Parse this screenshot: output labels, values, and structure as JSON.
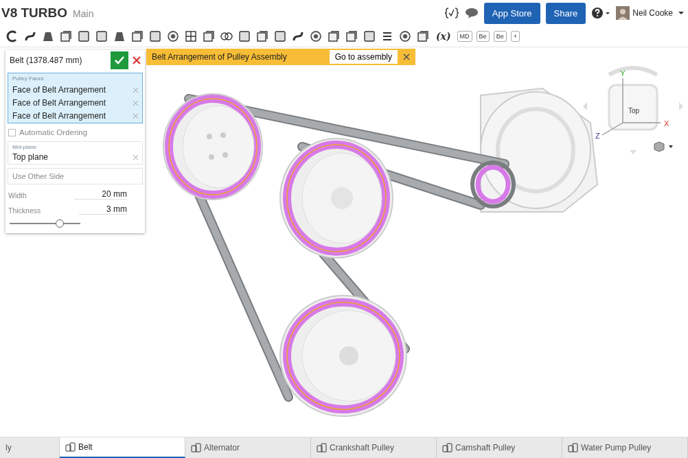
{
  "document": {
    "title": "V8 TURBO",
    "branch": "Main"
  },
  "top_bar": {
    "app_store": "App Store",
    "share": "Share",
    "user": "Neil Cooke"
  },
  "toolbar": {
    "text_tools": [
      "(x)",
      "MD",
      "Be",
      "Be",
      "+"
    ]
  },
  "feature_panel": {
    "title": "Belt (1378.487 mm)",
    "pulley_faces": {
      "label": "Pulley Faces",
      "items": [
        "Face of Belt Arrangement",
        "Face of Belt Arrangement",
        "Face of Belt Arrangement"
      ]
    },
    "automatic_ordering": {
      "label": "Automatic Ordering",
      "checked": false
    },
    "mid_plane": {
      "label": "Mid-plane",
      "value": "Top plane"
    },
    "use_other_side": {
      "placeholder": "Use Other Side"
    },
    "fields": [
      {
        "label": "Width",
        "value": "20 mm"
      },
      {
        "label": "Thickness",
        "value": "3 mm"
      }
    ],
    "slider": {
      "level": 0.7
    }
  },
  "banner": {
    "text": "Belt Arrangement of Pulley Assembly",
    "button": "Go to assembly"
  },
  "view_cube": {
    "face": "Top",
    "x": "X",
    "y": "Y",
    "z": "Z"
  },
  "tabs": [
    {
      "label": "ly",
      "selected": false,
      "kind": "assembly"
    },
    {
      "label": "Belt",
      "selected": true,
      "kind": "part_studio"
    },
    {
      "label": "Alternator",
      "selected": false,
      "kind": "part_studio"
    },
    {
      "label": "Crankshaft Pulley",
      "selected": false,
      "kind": "part_studio"
    },
    {
      "label": "Camshaft Pulley",
      "selected": false,
      "kind": "part_studio"
    },
    {
      "label": "Water Pump Pulley",
      "selected": false,
      "kind": "part_studio"
    }
  ]
}
